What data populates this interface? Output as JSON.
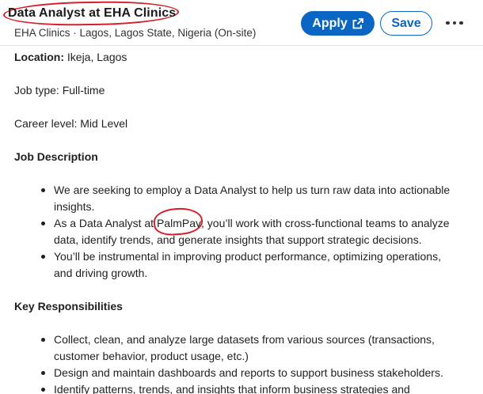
{
  "header": {
    "title": "Data Analyst at EHA Clinics",
    "subtitle": "EHA Clinics · Lagos, Lagos State, Nigeria (On-site)",
    "apply_label": "Apply",
    "save_label": "Save",
    "accent_color": "#0a66c2",
    "annotation_color": "#d4202a"
  },
  "details": {
    "location_label": "Location:",
    "location_value": " Ikeja, Lagos",
    "job_type": "Job type: Full-time",
    "career_level": "Career level: Mid Level"
  },
  "job_description": {
    "heading": "Job Description",
    "bullet1_line1": "We are seeking to employ a Data Analyst to help us turn raw data into actionable",
    "bullet1_line2": "insights.",
    "bullet2_pre": "As a Data Analyst at ",
    "bullet2_company": "PalmPay",
    "bullet2_post": ", you’ll work with cross-functional teams to analyze",
    "bullet2_line2": "data, identify trends, and generate insights that support strategic decisions.",
    "bullet3_line1": "You’ll be instrumental in improving product performance, optimizing operations,",
    "bullet3_line2": "and driving growth."
  },
  "responsibilities": {
    "heading": "Key Responsibilities",
    "bullet1_line1": "Collect, clean, and analyze large datasets from various sources (transactions,",
    "bullet1_line2": "customer behavior, product usage, etc.)",
    "bullet2": "Design and maintain dashboards and reports to support business stakeholders.",
    "bullet3": "Identify patterns, trends, and insights that inform business strategies and"
  },
  "icons": {
    "apply": "external-link-icon",
    "more": "more-options-icon"
  }
}
